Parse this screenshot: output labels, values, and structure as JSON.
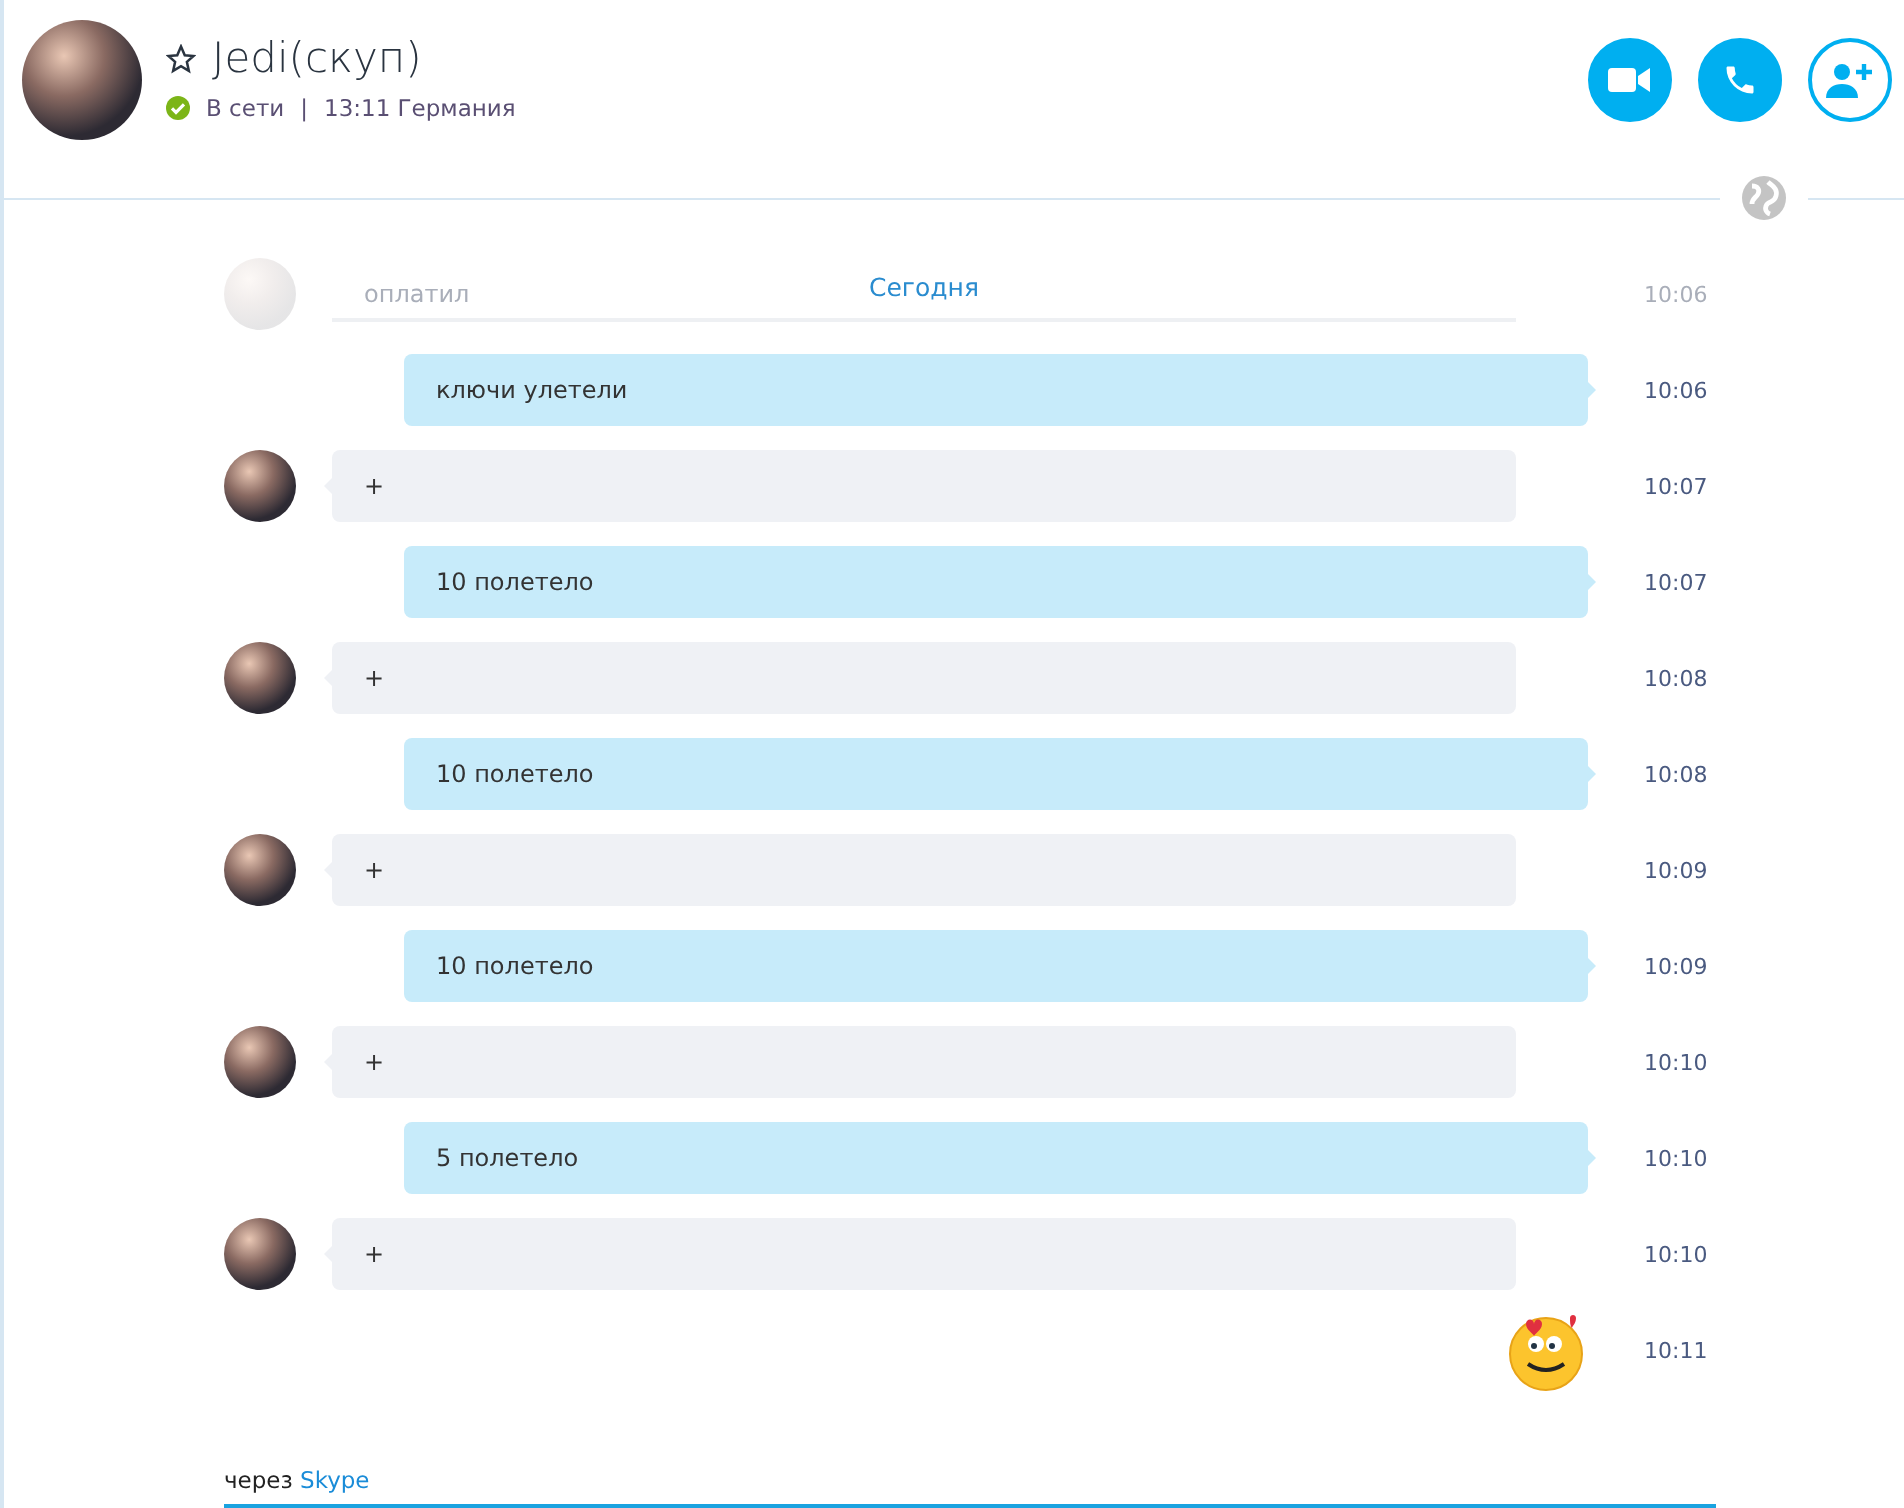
{
  "contact": {
    "name": "Jedi(скуп)",
    "favorite": false,
    "online": true,
    "status": "В сети",
    "separator": "|",
    "local_time": "13:11 Германия"
  },
  "date_header": "Сегодня",
  "faded_message": {
    "text": "оплатил",
    "time": "10:06"
  },
  "messages": [
    {
      "kind": "out",
      "text": "ключи улетели",
      "time": "10:06"
    },
    {
      "kind": "in",
      "text": "+",
      "time": "10:07"
    },
    {
      "kind": "out",
      "text": "10 полетело",
      "time": "10:07"
    },
    {
      "kind": "in",
      "text": "+",
      "time": "10:08"
    },
    {
      "kind": "out",
      "text": "10 полетело",
      "time": "10:08"
    },
    {
      "kind": "in",
      "text": "+",
      "time": "10:09"
    },
    {
      "kind": "out",
      "text": "10 полетело",
      "time": "10:09"
    },
    {
      "kind": "in",
      "text": "+",
      "time": "10:10"
    },
    {
      "kind": "out",
      "text": "5 полетело",
      "time": "10:10"
    },
    {
      "kind": "in",
      "text": "+",
      "time": "10:10"
    },
    {
      "kind": "emoji",
      "time": "10:11"
    }
  ],
  "footer": {
    "prefix": "через",
    "link": "Skype"
  }
}
